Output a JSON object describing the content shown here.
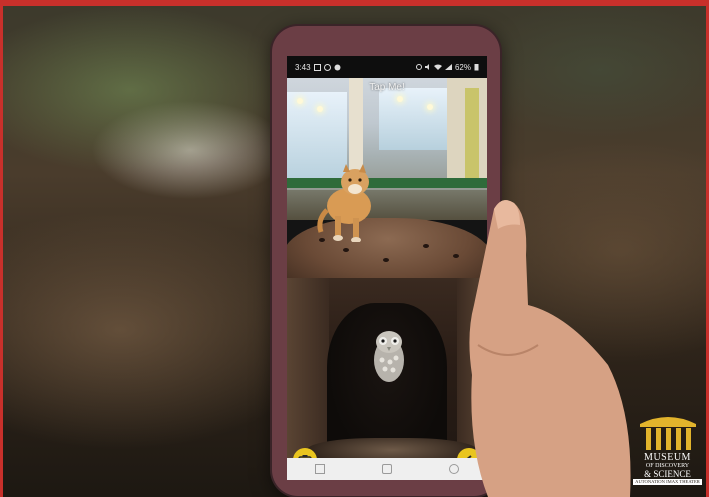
{
  "phone": {
    "status_bar": {
      "time": "3:43",
      "left_icons": [
        "image-icon",
        "chat-icon",
        "whatsapp-icon"
      ],
      "right_icons": [
        "alarm-icon",
        "mute-icon",
        "wifi-icon",
        "signal-icon"
      ],
      "battery": "62%"
    },
    "app": {
      "title": "Tap Me!",
      "camera_icon": "camera-icon",
      "back_icon": "back-arrow-icon"
    }
  },
  "logo": {
    "line1": "MUSEUM",
    "line2": "OF DISCOVERY",
    "line3": "& SCIENCE",
    "line4": "AUTONATION IMAX THEATER",
    "color": "#ffffff"
  },
  "colors": {
    "frame_border": "#c8302b",
    "phone_case": "#6b3e45",
    "accent_yellow": "#e9c51f"
  }
}
